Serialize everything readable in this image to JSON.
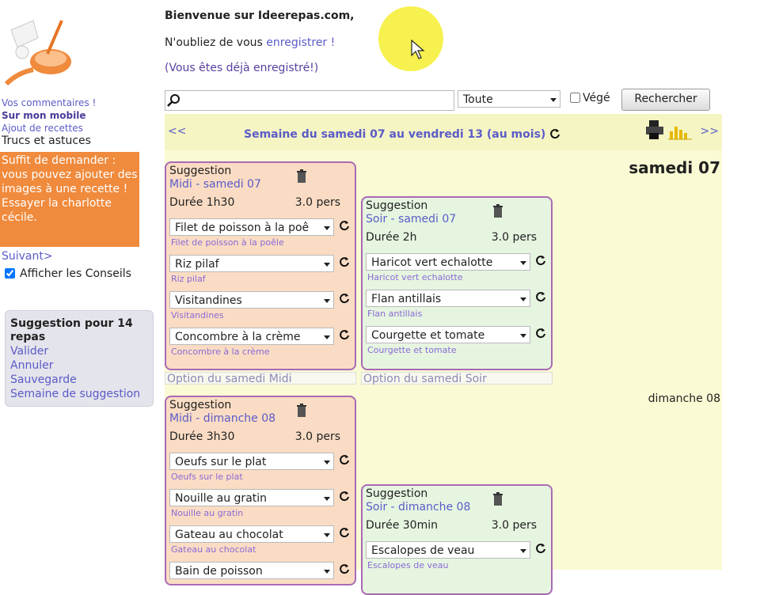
{
  "header": {
    "welcome": "Bienvenue sur Ideerepas.com,",
    "reminder_prefix": "N'oubliez de vous",
    "register_link": "enregistrer",
    "reminder_suffix": "!",
    "already_registered": "(Vous êtes déjà enregistré!)"
  },
  "sidebar": {
    "links": [
      "Vos commentaires !",
      "Sur mon mobile",
      "Ajout de recettes",
      "Trucs et astuces"
    ],
    "tip": "Suffit de demander : vous pouvez ajouter des images à une recette ! Essayer la charlotte cécile.",
    "next_label": "Suivant>",
    "show_tips_label": "Afficher les Conseils",
    "suggestion_box": {
      "title": "Suggestion pour 14 repas",
      "actions": [
        "Valider",
        "Annuler",
        "Sauvegarde",
        "Semaine de suggestion"
      ]
    }
  },
  "search": {
    "placeholder": "",
    "category_value": "Toute",
    "veg_label": "Végé",
    "button_label": "Rechercher"
  },
  "calendar": {
    "prev": "<<",
    "next": ">>",
    "week_title": "Semaine du samedi 07 au vendredi 13 (au mois)",
    "day1": "samedi 07",
    "day2": "dimanche 08",
    "meals": [
      {
        "kind": "Suggestion",
        "slot": "Midi - samedi 07",
        "duration": "Durée 1h30",
        "people": "3.0 pers",
        "dishes": [
          {
            "value": "Filet de poisson à la poê",
            "label": "Filet de poisson à la poêle"
          },
          {
            "value": "Riz pilaf",
            "label": "Riz pilaf"
          },
          {
            "value": "Visitandines",
            "label": "Visitandines"
          },
          {
            "value": "Concombre à la crème",
            "label": "Concombre à la crème"
          }
        ],
        "option": "Option du samedi Midi"
      },
      {
        "kind": "Suggestion",
        "slot": "Soir - samedi 07",
        "duration": "Durée 2h",
        "people": "3.0 pers",
        "dishes": [
          {
            "value": "Haricot vert echalotte",
            "label": "Haricot vert echalotte"
          },
          {
            "value": "Flan antillais",
            "label": "Flan antillais"
          },
          {
            "value": "Courgette et tomate",
            "label": "Courgette et tomate"
          }
        ],
        "option": "Option du samedi Soir"
      },
      {
        "kind": "Suggestion",
        "slot": "Midi - dimanche 08",
        "duration": "Durée 3h30",
        "people": "3.0 pers",
        "dishes": [
          {
            "value": "Oeufs sur le plat",
            "label": "Oeufs sur le plat"
          },
          {
            "value": "Nouille au gratin",
            "label": "Nouille au gratin"
          },
          {
            "value": "Gateau au chocolat",
            "label": "Gateau au chocolat"
          },
          {
            "value": "Bain de poisson",
            "label": ""
          }
        ]
      },
      {
        "kind": "Suggestion",
        "slot": "Soir - dimanche 08",
        "duration": "Durée 30min",
        "people": "3.0 pers",
        "dishes": [
          {
            "value": "Escalopes de veau",
            "label": "Escalopes de veau"
          }
        ]
      }
    ]
  },
  "colors": {
    "link": "#5b5bc8",
    "tip_bg": "#f08a3c",
    "midi_card_bg": "#fadcc4",
    "soir_card_bg": "#e6f5e0",
    "card_border": "#a86ab4",
    "calendar_bg": "#fafad4"
  }
}
